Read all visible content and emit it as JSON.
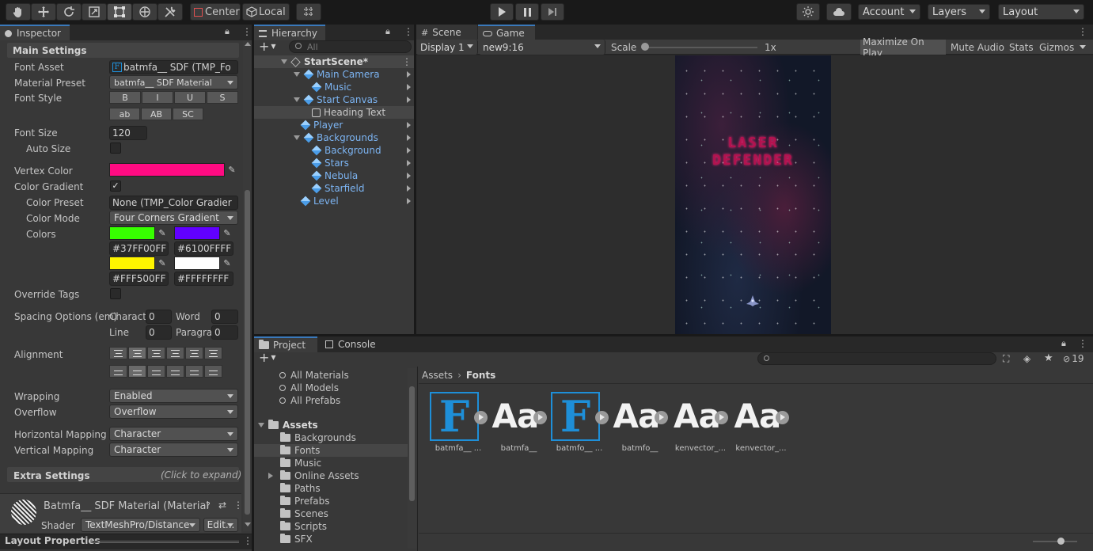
{
  "toolbar": {
    "tools": [
      "hand-tool",
      "move-tool",
      "rotate-tool",
      "scale-tool",
      "rect-tool",
      "transform-tool",
      "custom-tool"
    ],
    "pivot_label": "Center",
    "space_label": "Local",
    "account_label": "Account",
    "layers_label": "Layers",
    "layout_label": "Layout"
  },
  "inspector": {
    "tab": "Inspector",
    "main_settings": "Main Settings",
    "font_asset_label": "Font Asset",
    "font_asset_value": "batmfa__ SDF (TMP_Fo",
    "material_preset_label": "Material Preset",
    "material_preset_value": "batmfa__ SDF Material",
    "font_style_label": "Font Style",
    "style_row1": [
      "B",
      "I",
      "U",
      "S"
    ],
    "style_row2": [
      "ab",
      "AB",
      "SC"
    ],
    "font_size_label": "Font Size",
    "font_size_value": "120",
    "auto_size_label": "Auto Size",
    "vertex_color_label": "Vertex Color",
    "color_gradient_label": "Color Gradient",
    "color_gradient_check": "✓",
    "color_preset_label": "Color Preset",
    "color_preset_value": "None (TMP_Color Gradier",
    "color_mode_label": "Color Mode",
    "color_mode_value": "Four Corners Gradient",
    "colors_label": "Colors",
    "colors": [
      {
        "hex": "#37FF00FF",
        "swatch": "#37ff00"
      },
      {
        "hex": "#6100FFFF",
        "swatch": "#6100ff"
      },
      {
        "hex": "#FFF500FF",
        "swatch": "#fff500"
      },
      {
        "hex": "#FFFFFFFF",
        "swatch": "#ffffff"
      }
    ],
    "vertex_swatch": "#ff0b82",
    "override_tags_label": "Override Tags",
    "spacing_label": "Spacing Options (em)",
    "charact_label": "Charact",
    "charact_value": "0",
    "word_label": "Word",
    "word_value": "0",
    "line_label": "Line",
    "line_value": "0",
    "paragra_label": "Paragra",
    "paragra_value": "0",
    "alignment_label": "Alignment",
    "wrapping_label": "Wrapping",
    "wrapping_value": "Enabled",
    "overflow_label": "Overflow",
    "overflow_value": "Overflow",
    "hmapping_label": "Horizontal Mapping",
    "hmapping_value": "Character",
    "vmapping_label": "Vertical Mapping",
    "vmapping_value": "Character",
    "extra_settings": "Extra Settings",
    "click_to_expand": "(Click to expand)",
    "material_name": "Batmfa__ SDF Material (Material",
    "shader_label": "Shader",
    "shader_value": "TextMeshPro/Distance",
    "edit_label": "Edit...",
    "layout_properties": "Layout Properties"
  },
  "hierarchy": {
    "tab": "Hierarchy",
    "search_placeholder": "All",
    "scene": "StartScene*",
    "items": [
      {
        "label": "Main Camera",
        "indent": 1,
        "fold": true
      },
      {
        "label": "Music",
        "indent": 2,
        "fold": false
      },
      {
        "label": "Start Canvas",
        "indent": 1,
        "fold": true
      },
      {
        "label": "Heading Text",
        "indent": 2,
        "fold": false
      },
      {
        "label": "Player",
        "indent": 1,
        "fold": false
      },
      {
        "label": "Backgrounds",
        "indent": 1,
        "fold": true
      },
      {
        "label": "Background",
        "indent": 2,
        "fold": false
      },
      {
        "label": "Stars",
        "indent": 2,
        "fold": false
      },
      {
        "label": "Nebula",
        "indent": 2,
        "fold": false
      },
      {
        "label": "Starfield",
        "indent": 2,
        "fold": false
      },
      {
        "label": "Level",
        "indent": 1,
        "fold": false
      }
    ]
  },
  "game": {
    "scene_tab": "Scene",
    "game_tab": "Game",
    "display": "Display 1",
    "resolution": "new9:16",
    "scale_label": "Scale",
    "scale_value": "1x",
    "maximize": "Maximize On Play",
    "mute": "Mute Audio",
    "stats": "Stats",
    "gizmos": "Gizmos",
    "title_line1": "LASER",
    "title_line2": "DEFENDER"
  },
  "project": {
    "project_tab": "Project",
    "console_tab": "Console",
    "hidden_count": "19",
    "favorites": [
      "All Materials",
      "All Models",
      "All Prefabs"
    ],
    "assets_root": "Assets",
    "folders": [
      "Backgrounds",
      "Fonts",
      "Music",
      "Online Assets",
      "Paths",
      "Prefabs",
      "Scenes",
      "Scripts",
      "SFX"
    ],
    "breadcrumb_root": "Assets",
    "breadcrumb_current": "Fonts",
    "assets": [
      {
        "type": "font",
        "label": "batmfa__ ..."
      },
      {
        "type": "aa",
        "label": "batmfa__"
      },
      {
        "type": "font",
        "label": "batmfo__ ..."
      },
      {
        "type": "aa",
        "label": "batmfo__"
      },
      {
        "type": "aa",
        "label": "kenvector_..."
      },
      {
        "type": "aa",
        "label": "kenvector_..."
      }
    ]
  }
}
